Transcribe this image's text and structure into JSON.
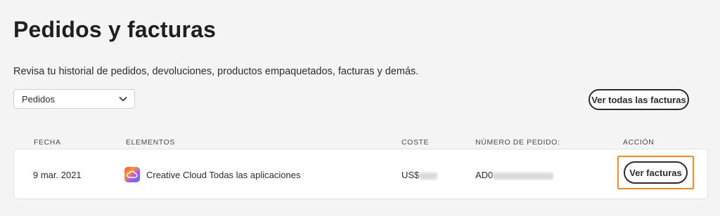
{
  "page": {
    "title": "Pedidos y facturas",
    "subtitle": "Revisa tu historial de pedidos, devoluciones, productos empaquetados, facturas y demás."
  },
  "filter": {
    "selected": "Pedidos",
    "icon": "chevron-down-icon"
  },
  "actions": {
    "view_all_invoices": "Ver todas las facturas"
  },
  "table": {
    "headers": {
      "date": "FECHA",
      "items": "ELEMENTOS",
      "cost": "COSTE",
      "order_number": "NÚMERO DE PEDIDO:",
      "action": "ACCIÓN"
    },
    "rows": [
      {
        "date": "9 mar. 2021",
        "item_icon": "creative-cloud-icon",
        "item": "Creative Cloud Todas las aplicaciones",
        "cost_prefix": "US$",
        "order_prefix": "AD0",
        "action_label": "Ver facturas"
      }
    ]
  },
  "colors": {
    "highlight": "#f28c1e",
    "background": "#f4f4f4",
    "text": "#2c2c2c"
  }
}
